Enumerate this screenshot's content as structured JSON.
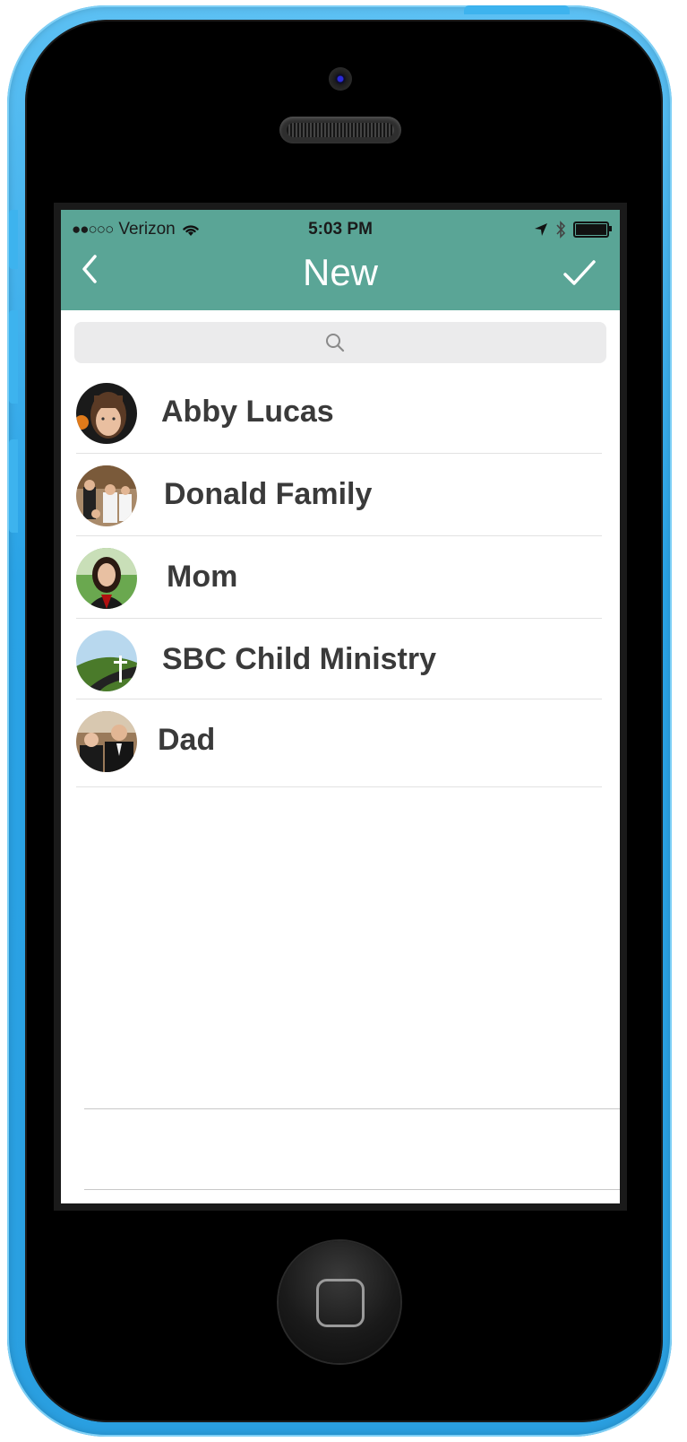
{
  "status_bar": {
    "signal": "●●○○○",
    "carrier": "Verizon",
    "time": "5:03 PM"
  },
  "nav": {
    "title": "New",
    "back_icon": "chevron-left-icon",
    "done_icon": "checkmark-icon"
  },
  "search": {
    "placeholder": "",
    "icon": "search-icon"
  },
  "contacts": [
    {
      "name": "Abby Lucas"
    },
    {
      "name": "Donald Family"
    },
    {
      "name": "Mom"
    },
    {
      "name": "SBC Child Ministry"
    },
    {
      "name": "Dad"
    }
  ],
  "colors": {
    "nav_bar": "#5aa596",
    "phone_shell": "#2aa3e6"
  }
}
